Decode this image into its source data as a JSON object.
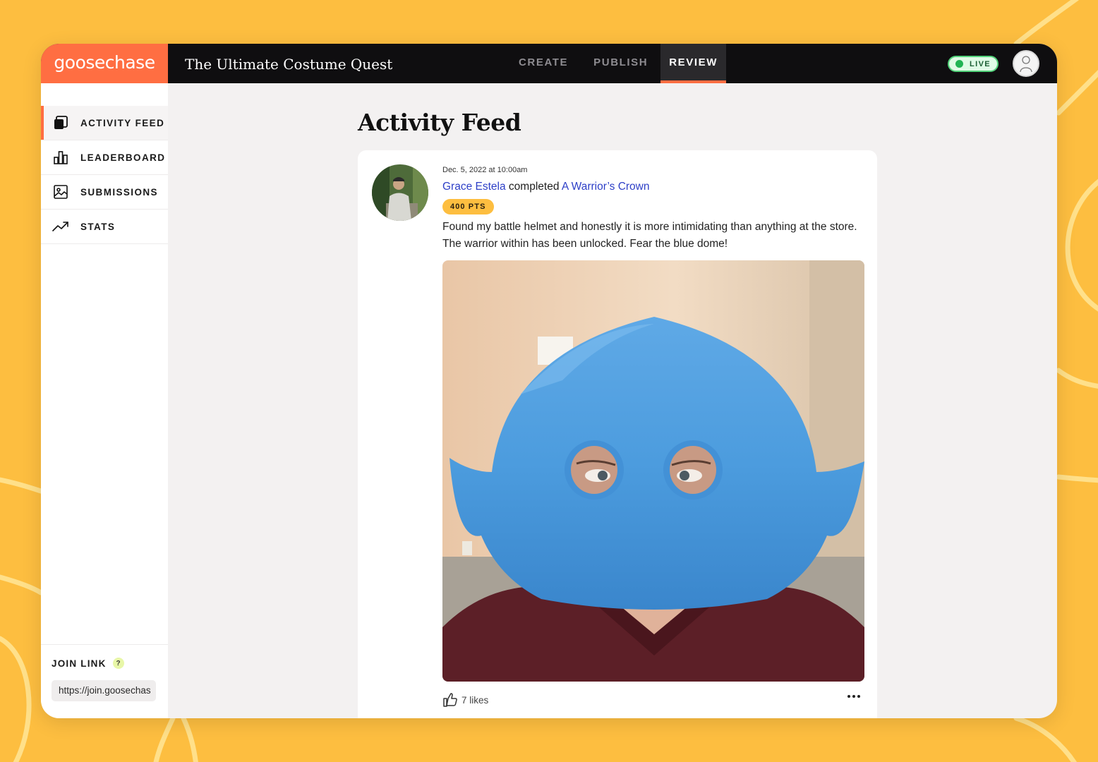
{
  "brand": {
    "name": "goosechase",
    "color": "#FF6E42"
  },
  "game": {
    "title": "The Ultimate Costume Quest"
  },
  "nav": {
    "tabs": [
      {
        "label": "CREATE",
        "active": false
      },
      {
        "label": "PUBLISH",
        "active": false
      },
      {
        "label": "REVIEW",
        "active": true
      }
    ]
  },
  "status": {
    "label": "LIVE",
    "color": "#22B455"
  },
  "sidebar": {
    "items": [
      {
        "label": "ACTIVITY FEED",
        "icon": "activity-feed-icon",
        "active": true
      },
      {
        "label": "LEADERBOARD",
        "icon": "leaderboard-icon",
        "active": false
      },
      {
        "label": "SUBMISSIONS",
        "icon": "submissions-icon",
        "active": false
      },
      {
        "label": "STATS",
        "icon": "stats-icon",
        "active": false
      }
    ],
    "join": {
      "title": "JOIN LINK",
      "help": "?",
      "url": "https://join.goosechas"
    }
  },
  "page": {
    "title": "Activity Feed"
  },
  "post": {
    "timestamp": "Dec. 5, 2022 at 10:00am",
    "author": "Grace Estela",
    "verb": "completed",
    "mission": "A Warrior’s Crown",
    "points": "400 PTS",
    "caption": "Found my battle helmet and honestly it is more intimidating than anything at the store. The warrior within has been unlocked. Fear the blue dome!",
    "likes": "7 likes"
  }
}
